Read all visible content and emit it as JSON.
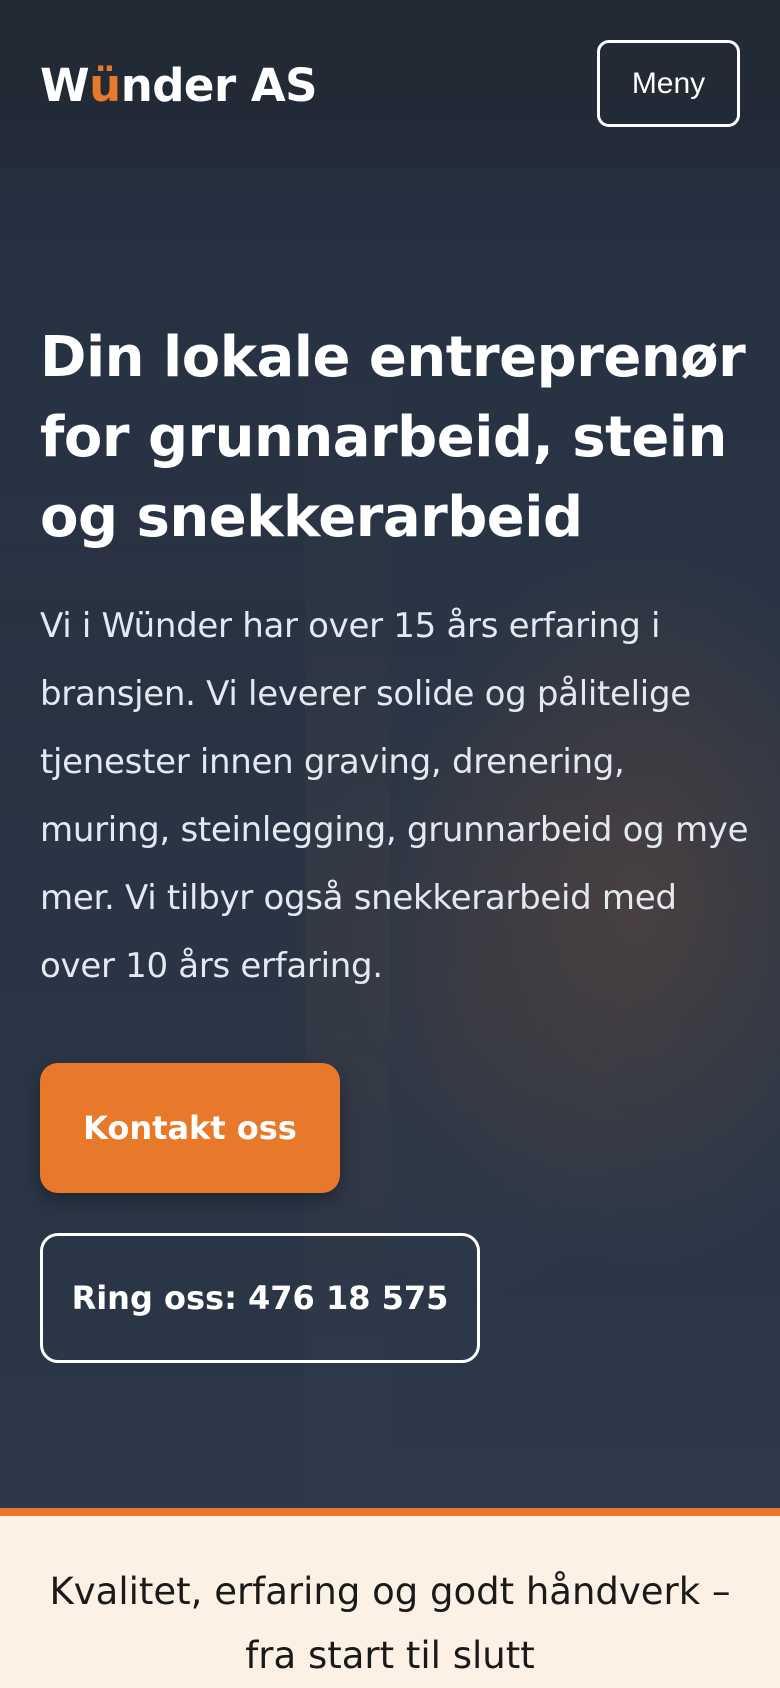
{
  "header": {
    "logo_prefix": "W",
    "logo_accent": "ü",
    "logo_suffix": "nder AS",
    "menu_label": "Meny"
  },
  "hero": {
    "title": "Din lokale entreprenør for grunnarbeid, stein og snekkerarbeid",
    "text": "Vi i Wünder har over 15 års erfaring i bransjen. Vi leverer solide og pålitelige tjenester innen graving, drenering, muring, steinlegging, grunnarbeid og mye mer. Vi tilbyr også snekkerarbeid med over 10 års erfaring.",
    "primary_button": "Kontakt oss",
    "secondary_button": "Ring oss: 476 18 575"
  },
  "tagline": {
    "text": "Kvalitet, erfaring og godt håndverk – fra start til slutt"
  },
  "colors": {
    "accent": "#e8782a",
    "hero_background": "#2b3646",
    "tagline_background": "#fdf1e6"
  }
}
